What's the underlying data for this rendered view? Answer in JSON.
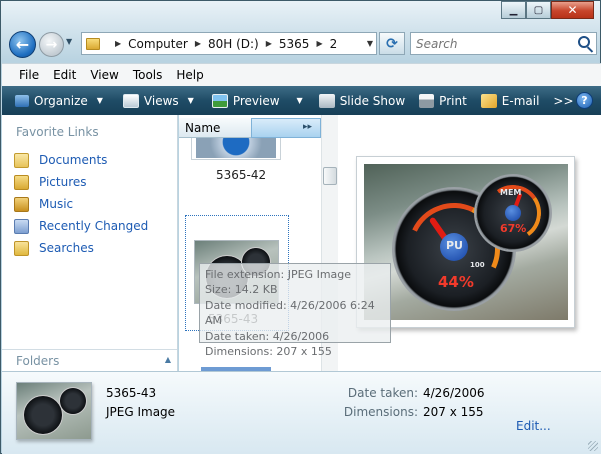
{
  "window": {
    "minimize_glyph": "▁",
    "maximize_glyph": "▢",
    "close_glyph": "✕"
  },
  "navigation": {
    "back_glyph": "←",
    "forward_glyph": "→",
    "dropdown_glyph": "▼"
  },
  "address": {
    "sep": "▶",
    "crumbs": [
      "Computer",
      "80H (D:)",
      "5365",
      "2"
    ],
    "refresh_glyph": "⟳"
  },
  "search": {
    "placeholder": "Search",
    "icon": "search-icon"
  },
  "menu": {
    "items": [
      "File",
      "Edit",
      "View",
      "Tools",
      "Help"
    ]
  },
  "commandbar": {
    "organize": "Organize",
    "views": "Views",
    "preview": "Preview",
    "slideshow": "Slide Show",
    "print": "Print",
    "email": "E-mail",
    "more": ">>",
    "help": "?",
    "arrow_glyph": "▼"
  },
  "sidebar": {
    "title": "Favorite Links",
    "items": [
      {
        "label": "Documents",
        "icon": "documents-icon",
        "color": "#e7c35a"
      },
      {
        "label": "Pictures",
        "icon": "pictures-icon",
        "color": "#e0b640"
      },
      {
        "label": "Music",
        "icon": "music-icon",
        "color": "#d8a22e"
      },
      {
        "label": "Recently Changed",
        "icon": "recent-icon",
        "color": "#7d9fd0"
      },
      {
        "label": "Searches",
        "icon": "searches-icon",
        "color": "#e4c04c"
      }
    ],
    "folders_label": "Folders",
    "folders_chevron": "▲"
  },
  "filelist": {
    "column_header": "Name",
    "column_chevron": "▸▸",
    "items": [
      {
        "name": "5365-42"
      },
      {
        "name": "5365-43"
      }
    ]
  },
  "tooltip": {
    "lines": [
      "File extension: JPEG Image",
      "Size: 14.2 KB",
      "Date modified: 4/26/2006 6:24 AM",
      "Date taken: 4/26/2006",
      "Dimensions: 207 x 155"
    ]
  },
  "preview": {
    "cpu_label": "PU",
    "cpu_value": "44%",
    "mem_label": "MEM",
    "mem_value": "67%",
    "scale_value": "100"
  },
  "details": {
    "name": "5365-43",
    "type": "JPEG Image",
    "date_taken_label": "Date taken:",
    "date_taken_value": "4/26/2006",
    "dimensions_label": "Dimensions:",
    "dimensions_value": "207 x 155",
    "edit_label": "Edit..."
  },
  "colors": {
    "accent": "#1d5bb3",
    "commandbar": "#1f4c66",
    "gauge_red": "#f23a2b"
  }
}
